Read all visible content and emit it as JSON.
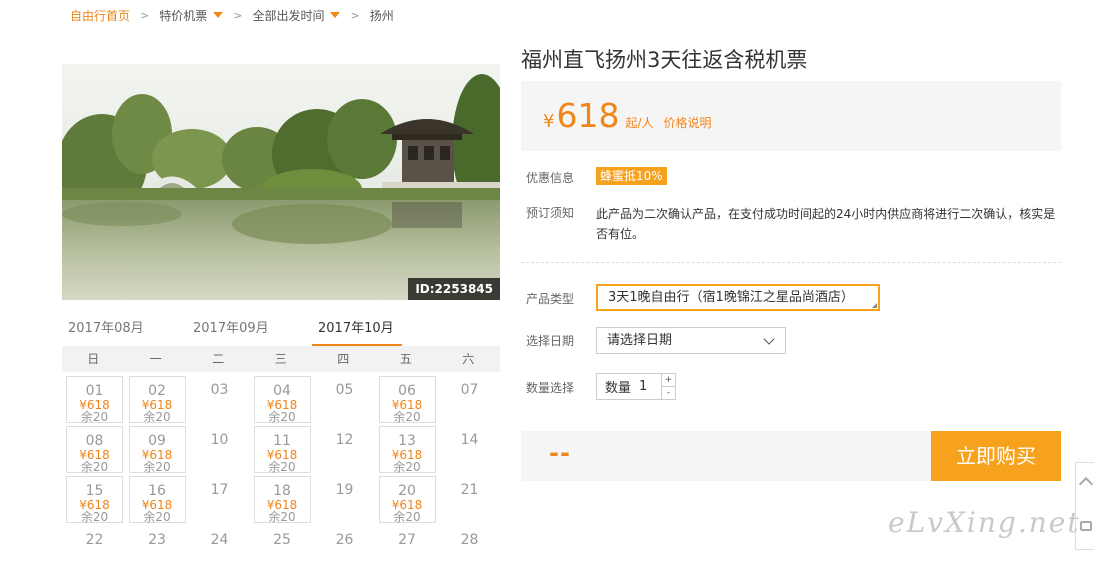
{
  "breadcrumb": [
    {
      "label": "自由行首页",
      "caret": false,
      "sep": true
    },
    {
      "label": "特价机票",
      "caret": true,
      "sep": true
    },
    {
      "label": "全部出发时间",
      "caret": true,
      "sep": true
    },
    {
      "label": "扬州",
      "caret": false,
      "sep": false
    }
  ],
  "photo": {
    "id_label": "ID:2253845"
  },
  "calendar": {
    "tabs": [
      "2017年08月",
      "2017年09月",
      "2017年10月"
    ],
    "active_tab": 2,
    "weekdays": [
      "日",
      "一",
      "二",
      "三",
      "四",
      "五",
      "六"
    ],
    "weeks": [
      [
        {
          "day": "01",
          "price": "¥618",
          "stock": "余20"
        },
        {
          "day": "02",
          "price": "¥618",
          "stock": "余20"
        },
        {
          "day": "03"
        },
        {
          "day": "04",
          "price": "¥618",
          "stock": "余20"
        },
        {
          "day": "05"
        },
        {
          "day": "06",
          "price": "¥618",
          "stock": "余20"
        },
        {
          "day": "07"
        }
      ],
      [
        {
          "day": "08",
          "price": "¥618",
          "stock": "余20"
        },
        {
          "day": "09",
          "price": "¥618",
          "stock": "余20"
        },
        {
          "day": "10"
        },
        {
          "day": "11",
          "price": "¥618",
          "stock": "余20"
        },
        {
          "day": "12"
        },
        {
          "day": "13",
          "price": "¥618",
          "stock": "余20"
        },
        {
          "day": "14"
        }
      ],
      [
        {
          "day": "15",
          "price": "¥618",
          "stock": "余20"
        },
        {
          "day": "16",
          "price": "¥618",
          "stock": "余20"
        },
        {
          "day": "17"
        },
        {
          "day": "18",
          "price": "¥618",
          "stock": "余20"
        },
        {
          "day": "19"
        },
        {
          "day": "20",
          "price": "¥618",
          "stock": "余20"
        },
        {
          "day": "21"
        }
      ],
      [
        {
          "day": "22"
        },
        {
          "day": "23"
        },
        {
          "day": "24"
        },
        {
          "day": "25"
        },
        {
          "day": "26"
        },
        {
          "day": "27"
        },
        {
          "day": "28"
        }
      ]
    ]
  },
  "product": {
    "title": "福州直飞扬州3天往返含税机票",
    "price": {
      "currency": "¥",
      "amount": "618",
      "unit": "起/人",
      "note_link": "价格说明"
    },
    "promo": {
      "label": "优惠信息",
      "badge": "蜂蜜抵10%"
    },
    "booking_notice": {
      "label": "预订须知",
      "text": "此产品为二次确认产品，在支付成功时间起的24小时内供应商将进行二次确认，核实是否有位。"
    },
    "type": {
      "label": "产品类型",
      "value": "3天1晚自由行（宿1晚锦江之星品尚酒店）"
    },
    "date": {
      "label": "选择日期",
      "placeholder": "请选择日期"
    },
    "quantity": {
      "label": "数量选择",
      "inner_label": "数量",
      "value": "1",
      "plus": "+",
      "minus": "-"
    },
    "total": "--",
    "buy_button": "立即购买"
  },
  "watermark": "eLvXing.net",
  "colors": {
    "accent": "#f08519",
    "button": "#f7a21d"
  }
}
